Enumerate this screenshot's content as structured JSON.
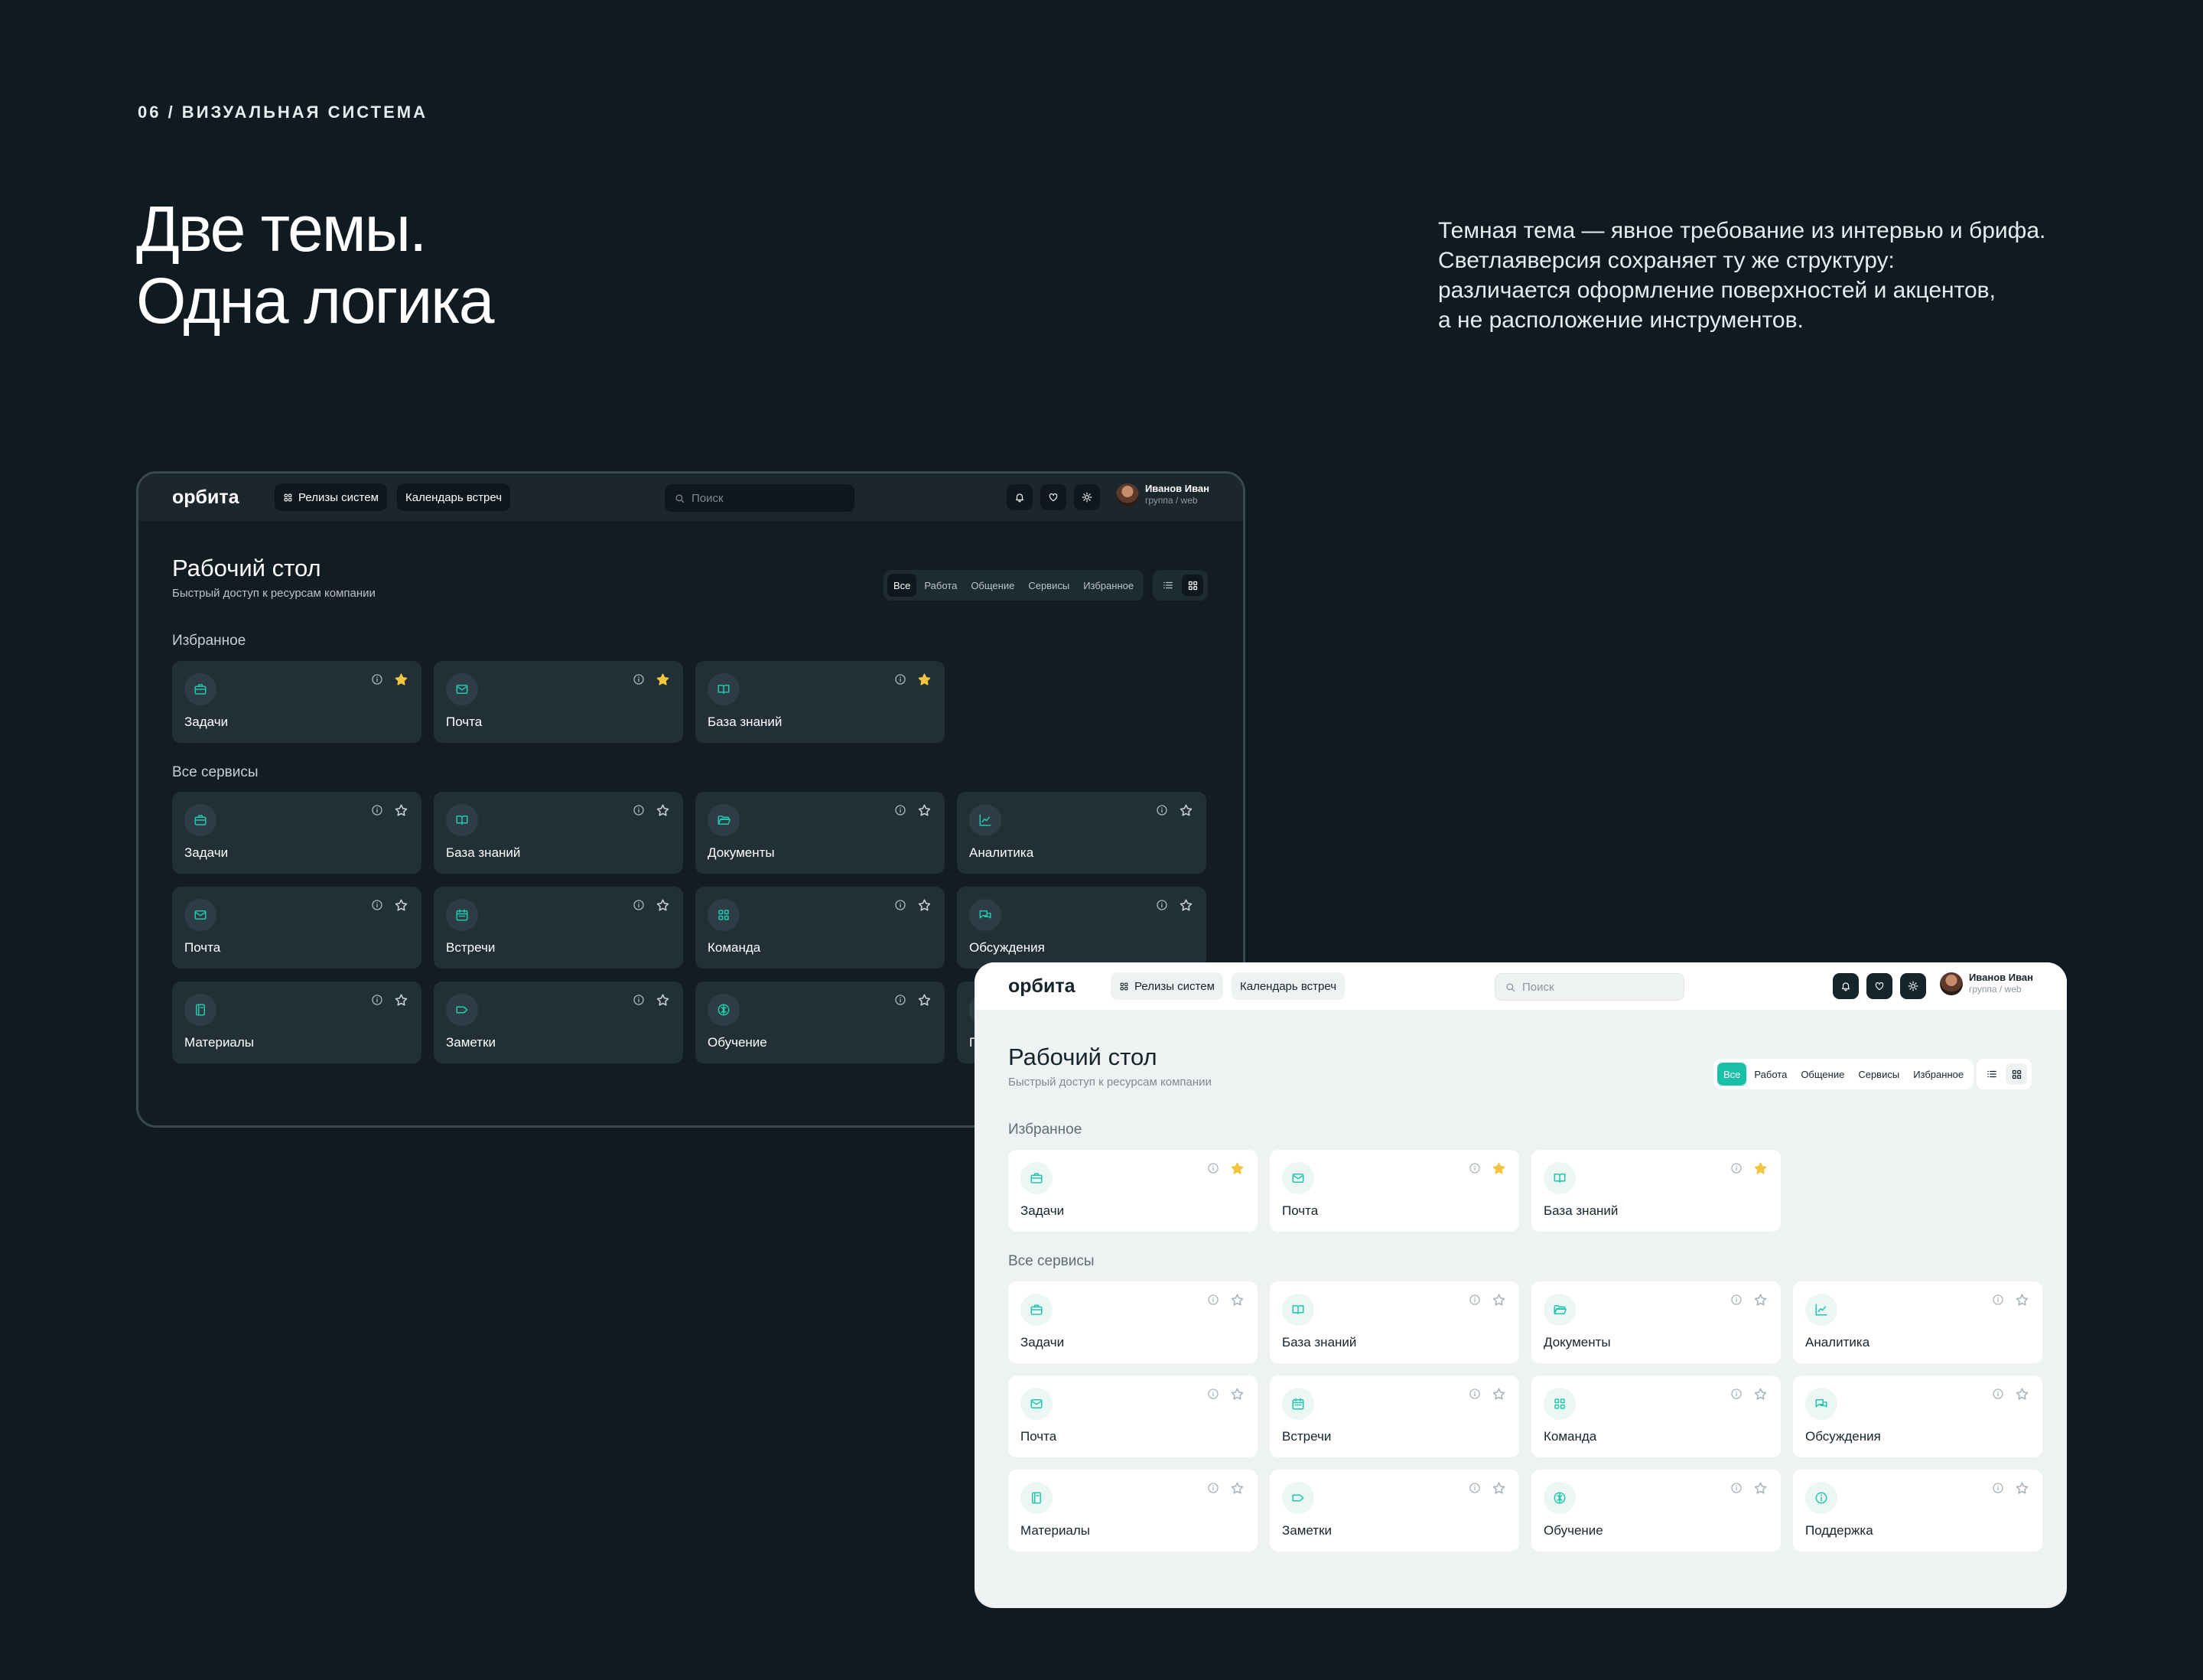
{
  "slide": {
    "section_label": "06 / ВИЗУАЛЬНАЯ СИСТЕМА",
    "headline_line1": "Две темы.",
    "headline_line2": "Одна логика",
    "description_lines": [
      "Темная тема — явное требование из интервью и брифа.",
      "Светлаяверсия сохраняет ту же структуру:",
      "различается оформление поверхностей и акцентов,",
      "а не расположение инструментов."
    ]
  },
  "colors": {
    "accent": "#21c7ad",
    "star_active": "#f3c53f",
    "page_bg": "#101a21",
    "dark_card": "#222f36",
    "light_bg": "#eef2f3"
  },
  "app": {
    "logo": "орбита",
    "nav": [
      "Релизы систем",
      "Календарь встреч"
    ],
    "search_placeholder": "Поиск",
    "header_icons": [
      "bell-icon",
      "heart-icon",
      "sun-icon"
    ],
    "user": {
      "name": "Иванов Иван",
      "group": "группа / web"
    },
    "page_title": "Рабочий стол",
    "page_subtitle": "Быстрый доступ к ресурсам компании",
    "filters": [
      "Все",
      "Работа",
      "Общение",
      "Сервисы",
      "Избранное"
    ],
    "active_filter": "Все",
    "favorites_title": "Избранное",
    "all_title": "Все сервисы",
    "favorites": [
      {
        "label": "Задачи",
        "icon": "briefcase-icon",
        "starred": true
      },
      {
        "label": "Почта",
        "icon": "mail-icon",
        "starred": true
      },
      {
        "label": "База знаний",
        "icon": "book-icon",
        "starred": true
      }
    ],
    "services": [
      {
        "label": "Задачи",
        "icon": "briefcase-icon",
        "starred": false
      },
      {
        "label": "База знаний",
        "icon": "book-icon",
        "starred": false
      },
      {
        "label": "Документы",
        "icon": "folder-icon",
        "starred": false
      },
      {
        "label": "Аналитика",
        "icon": "chart-icon",
        "starred": false
      },
      {
        "label": "Почта",
        "icon": "mail-icon",
        "starred": false
      },
      {
        "label": "Встречи",
        "icon": "calendar-icon",
        "starred": false
      },
      {
        "label": "Команда",
        "icon": "grid-icon",
        "starred": false
      },
      {
        "label": "Обсуждения",
        "icon": "chat-icon",
        "starred": false
      },
      {
        "label": "Материалы",
        "icon": "document-icon",
        "starred": false
      },
      {
        "label": "Заметки",
        "icon": "tag-icon",
        "starred": false
      },
      {
        "label": "Обучение",
        "icon": "brain-icon",
        "starred": false
      },
      {
        "label": "Поддержка",
        "icon": "support-icon",
        "starred": false
      }
    ]
  }
}
